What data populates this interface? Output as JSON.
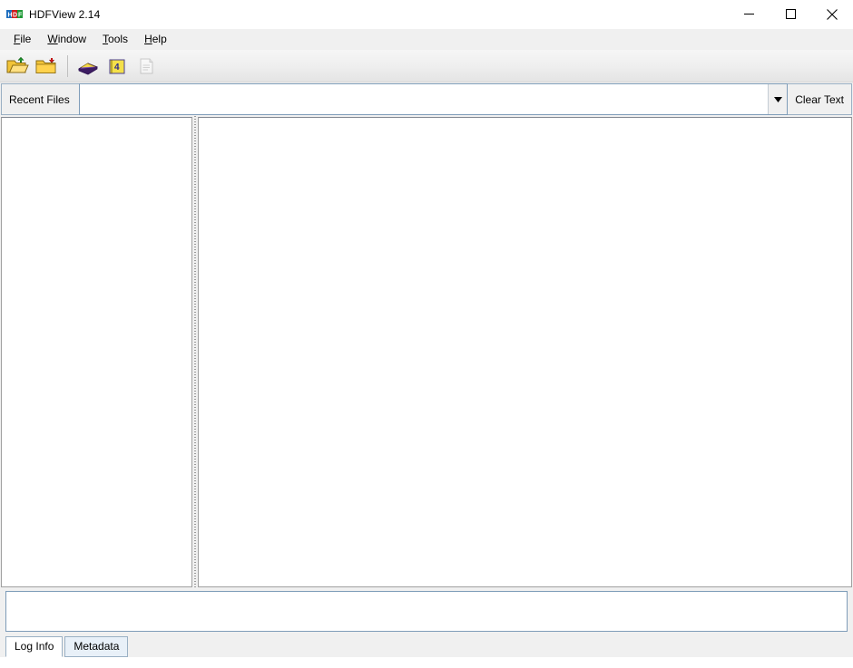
{
  "window": {
    "title": "HDFView 2.14",
    "app_icon_name": "hdf-logo-icon",
    "controls": {
      "minimize_label": "─",
      "maximize_label": "□",
      "close_label": "✕"
    }
  },
  "menubar": {
    "items": [
      {
        "label": "File",
        "mnemonic": "F"
      },
      {
        "label": "Window",
        "mnemonic": "W"
      },
      {
        "label": "Tools",
        "mnemonic": "T"
      },
      {
        "label": "Help",
        "mnemonic": "H"
      }
    ]
  },
  "toolbar": {
    "buttons": [
      {
        "name": "open-file-button",
        "icon": "open-folder-icon",
        "enabled": true
      },
      {
        "name": "close-file-button",
        "icon": "closed-folder-icon",
        "enabled": true
      },
      {
        "name": "hdf4-library-button",
        "icon": "hdf4-book-icon",
        "enabled": true
      },
      {
        "name": "hdf5-library-button",
        "icon": "hdf5-book-icon",
        "enabled": true
      },
      {
        "name": "help-page-button",
        "icon": "document-icon",
        "enabled": false
      }
    ]
  },
  "recent_files": {
    "label": "Recent Files",
    "combo_value": "",
    "combo_placeholder": "",
    "dropdown_icon": "chevron-down-icon",
    "clear_label": "Clear Text"
  },
  "main": {
    "tree_panel": {
      "name": "file-tree-panel",
      "content": ""
    },
    "content_panel": {
      "name": "data-content-panel",
      "content": ""
    },
    "splitter": {
      "name": "panel-splitter"
    }
  },
  "bottom": {
    "log_text": "",
    "tabs": [
      {
        "label": "Log Info",
        "selected": true
      },
      {
        "label": "Metadata",
        "selected": false
      }
    ]
  },
  "colors": {
    "window_bg": "#f0f0f0",
    "panel_bg": "#ffffff",
    "border": "#a0a0a0",
    "field_border": "#7f9db9",
    "tab_border": "#9ab0c4",
    "accent_blue": "#e8f0f8"
  }
}
